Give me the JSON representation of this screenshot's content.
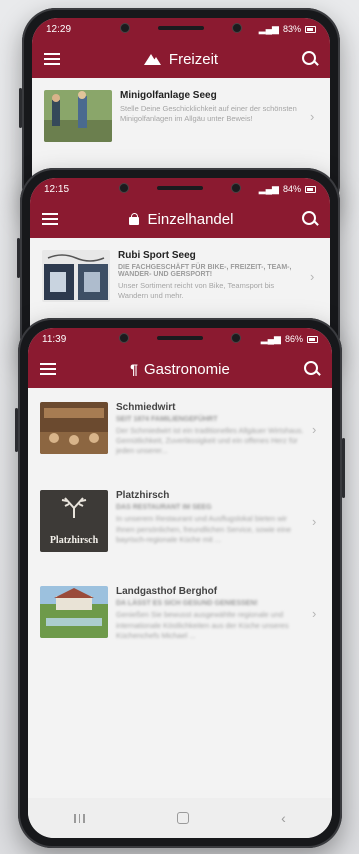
{
  "phones": [
    {
      "status_time": "12:29",
      "battery": "83%",
      "title": "Freizeit",
      "title_icon": "mountain-icon",
      "listings": [
        {
          "name": "Minigolfanlage Seeg",
          "tagline": "",
          "description": "Stelle Deine Geschicklichkeit auf einer der schönsten Minigolfanlagen im Allgäu unter Beweis!"
        }
      ]
    },
    {
      "status_time": "12:15",
      "battery": "84%",
      "title": "Einzelhandel",
      "title_icon": "shopping-bag-icon",
      "listings": [
        {
          "name": "Rubi Sport Seeg",
          "tagline": "DIE FACHGESCHÄFT FÜR BIKE-, FREIZEIT-, TEAM-, WANDER- UND GERSPORT!",
          "description": "Unser Sortiment reicht von Bike, Teamsport bis Wandern und mehr."
        }
      ]
    },
    {
      "status_time": "11:39",
      "battery": "86%",
      "title": "Gastronomie",
      "title_icon": "cutlery-icon",
      "listings": [
        {
          "name": "Schmiedwirt",
          "tagline": "SEIT 1874 FAMILIENGEFÜHRT",
          "description": "Der Schmiedwirt ist ein traditionelles Allgäuer Wirtshaus. Gemütlichkeit, Zuverlässigkeit und ein offenes Herz für jeden unserer..."
        },
        {
          "name": "Platzhirsch",
          "tagline": "DAS RESTAURANT IM SEEG",
          "description": "In unserem Restaurant und Ausflugslokal bieten wir Ihnen persönlichen, freundlichen Service, sowie eine bayrisch-regionale Küche mit ...",
          "logo_text": "Platzhirsch"
        },
        {
          "name": "Landgasthof Berghof",
          "tagline": "DA LÄSST ES SICH GESUND GENIESSEN!",
          "description": "Genießen Sie bewusst ausgewählte regionale und internationale Köstlichkeiten aus der Küche unseres Küchenchefs Michael ..."
        }
      ]
    }
  ],
  "colors": {
    "brand": "#8b1a30",
    "list_background": "#f3f3f3",
    "muted_text": "#a5a5a5"
  }
}
